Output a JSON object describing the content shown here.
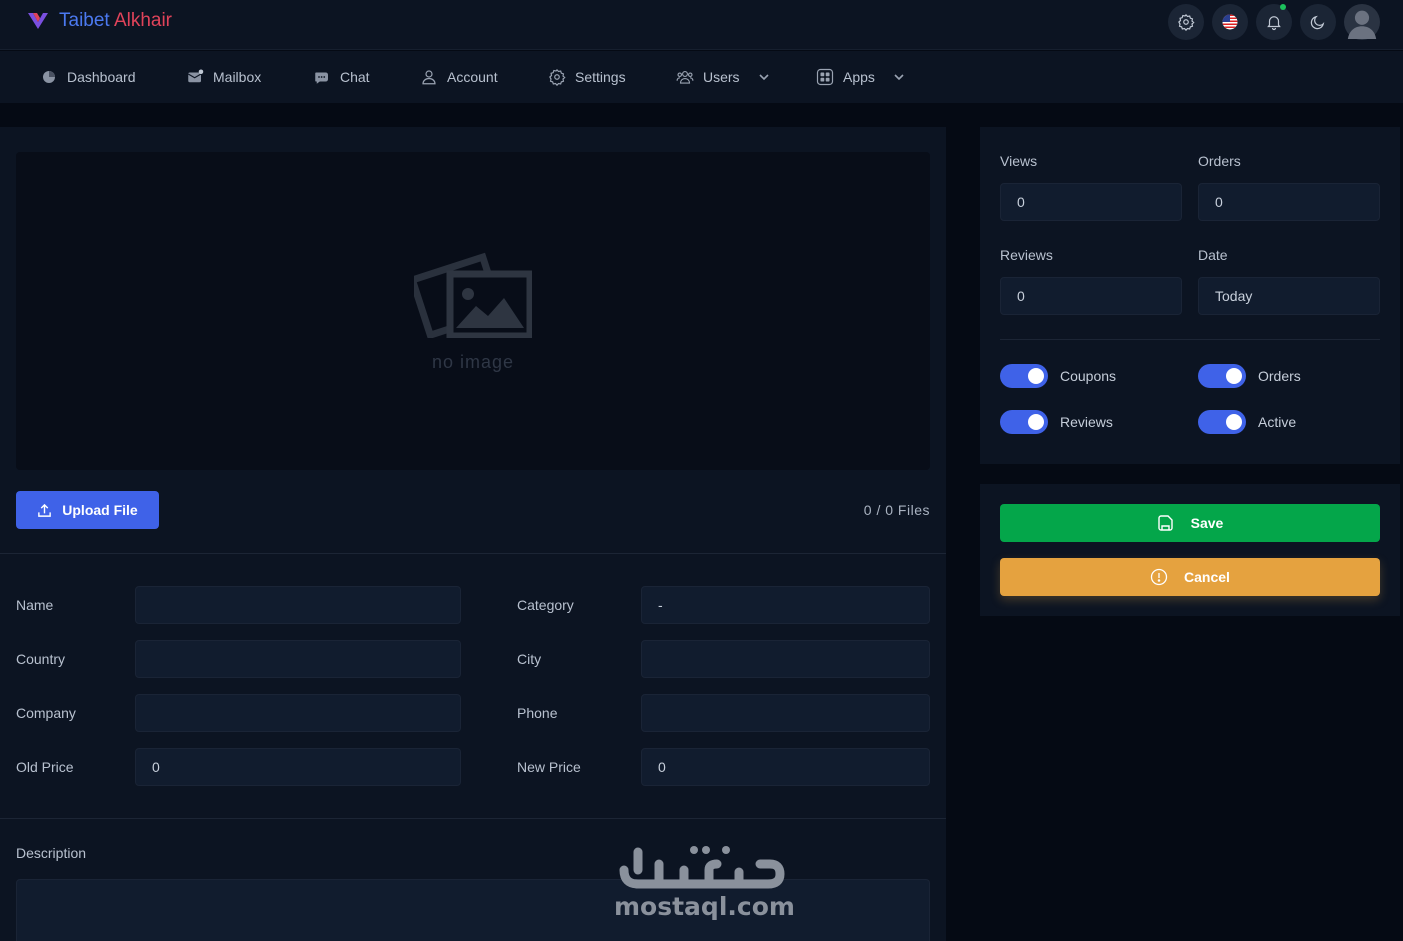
{
  "brand": {
    "name_part1": "Taibet",
    "name_part2": "Alkhair",
    "accent": "#4b79f0",
    "accent2": "#e0435a"
  },
  "topbar": {
    "icons": [
      "gear-icon",
      "us-flag-icon",
      "bell-icon",
      "moon-icon",
      "user-avatar"
    ]
  },
  "nav": {
    "items": [
      {
        "label": "Dashboard",
        "icon": "pie-chart-icon"
      },
      {
        "label": "Mailbox",
        "icon": "mail-icon"
      },
      {
        "label": "Chat",
        "icon": "chat-bubble-icon"
      },
      {
        "label": "Account",
        "icon": "user-icon"
      },
      {
        "label": "Settings",
        "icon": "gear-icon"
      },
      {
        "label": "Users",
        "icon": "users-icon",
        "dropdown": true
      },
      {
        "label": "Apps",
        "icon": "grid-icon",
        "dropdown": true
      }
    ]
  },
  "image": {
    "placeholder": "no image"
  },
  "upload": {
    "button_label": "Upload File",
    "files_count": "0 / 0 Files"
  },
  "form": {
    "name": {
      "label": "Name",
      "value": ""
    },
    "category": {
      "label": "Category",
      "value": "-"
    },
    "country": {
      "label": "Country",
      "value": ""
    },
    "city": {
      "label": "City",
      "value": ""
    },
    "company": {
      "label": "Company",
      "value": ""
    },
    "phone": {
      "label": "Phone",
      "value": ""
    },
    "old_price": {
      "label": "Old Price",
      "value": "0"
    },
    "new_price": {
      "label": "New Price",
      "value": "0"
    },
    "description": {
      "label": "Description",
      "value": ""
    }
  },
  "stats": {
    "views": {
      "label": "Views",
      "value": "0"
    },
    "orders": {
      "label": "Orders",
      "value": "0"
    },
    "reviews": {
      "label": "Reviews",
      "value": "0"
    },
    "date": {
      "label": "Date",
      "value": "Today"
    }
  },
  "toggles": {
    "coupons": {
      "label": "Coupons",
      "on": true
    },
    "orders": {
      "label": "Orders",
      "on": true
    },
    "reviews": {
      "label": "Reviews",
      "on": true
    },
    "active": {
      "label": "Active",
      "on": true
    }
  },
  "actions": {
    "save_label": "Save",
    "save_color": "#04a64a",
    "cancel_label": "Cancel",
    "cancel_color": "#e5a23f"
  },
  "watermark": {
    "arabic": "مستقل",
    "text": "mostaql.com"
  }
}
